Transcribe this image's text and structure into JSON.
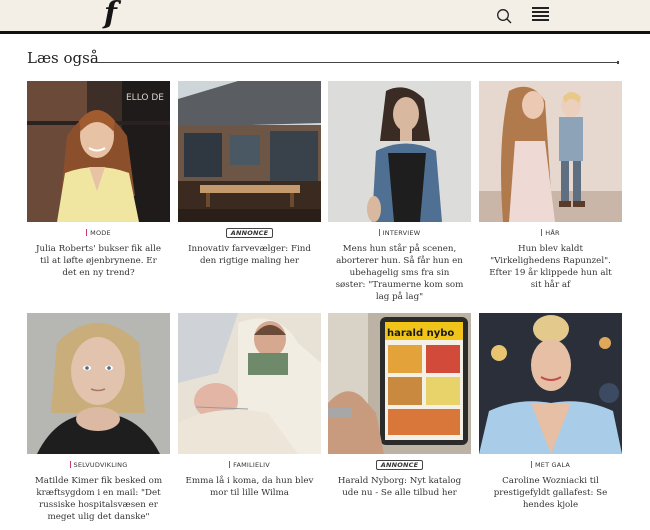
{
  "header": {
    "logo": "f",
    "search_icon": "search-icon",
    "menu_icon": "hamburger-menu-icon",
    "background": "#f3efe6"
  },
  "section": {
    "title": "Læs også"
  },
  "accent": "#d6356b",
  "articles": [
    {
      "tag": "MODE",
      "sponsored": false,
      "title": "Julia Roberts' bukser fik alle til at løfte øjenbrynene. Er det en ny trend?"
    },
    {
      "tag": "ANNONCE",
      "sponsored": true,
      "title": "Innovativ farvevælger: Find den rigtige maling her"
    },
    {
      "tag": "INTERVIEW",
      "sponsored": false,
      "title": "Mens hun står på scenen, aborterer hun. Så får hun en ubehagelig sms fra sin søster: \"Traumerne kom som lag på lag\""
    },
    {
      "tag": "HÅR",
      "sponsored": false,
      "title": "Hun blev kaldt \"Virkelighedens Rapunzel\". Efter 19 år klippede hun alt sit hår af"
    },
    {
      "tag": "SELVUDVIKLING",
      "sponsored": false,
      "title": "Matilde Kimer fik besked om kræftsygdom i en mail: \"Det russiske hospitalsvæsen er meget ulig det danske\""
    },
    {
      "tag": "FAMILIELIV",
      "sponsored": false,
      "title": "Emma lå i koma, da hun blev mor til lille Wilma"
    },
    {
      "tag": "ANNONCE",
      "sponsored": true,
      "title": "Harald Nyborg: Nyt katalog ude nu - Se alle tilbud her"
    },
    {
      "tag": "MET GALA",
      "sponsored": false,
      "title": "Caroline Wozniacki til prestigefyldt gallafest: Se hendes kjole"
    }
  ],
  "thumb_labels": {
    "storefront": "ELLO DE",
    "catalog": "harald nybo"
  }
}
